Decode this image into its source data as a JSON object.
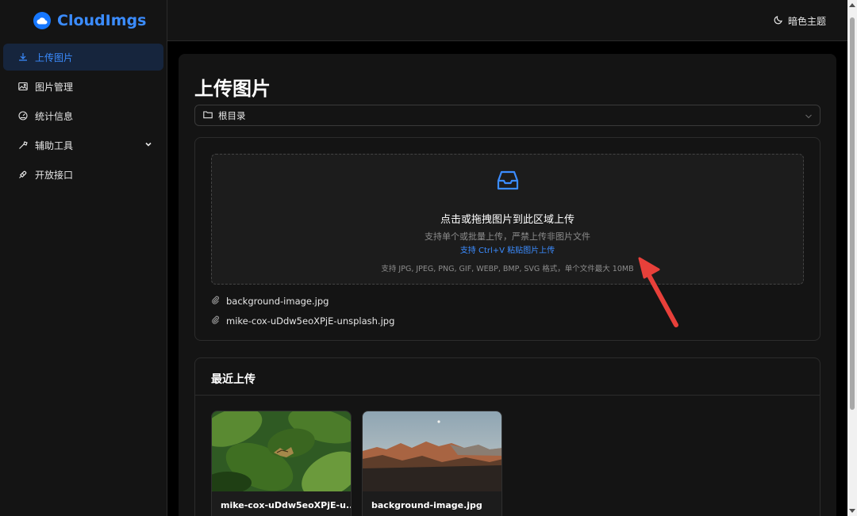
{
  "app": {
    "brand": "CloudImgs"
  },
  "sidebar": {
    "items": [
      {
        "label": "上传图片",
        "icon": "upload-icon",
        "active": true
      },
      {
        "label": "图片管理",
        "icon": "image-icon"
      },
      {
        "label": "统计信息",
        "icon": "dashboard-icon"
      },
      {
        "label": "辅助工具",
        "icon": "tool-icon",
        "expandable": true
      },
      {
        "label": "开放接口",
        "icon": "api-icon"
      }
    ]
  },
  "topbar": {
    "theme_label": "暗色主题"
  },
  "main": {
    "title": "上传图片",
    "directory": {
      "selected": "根目录"
    },
    "dropzone": {
      "title": "点击或拖拽图片到此区域上传",
      "hint": "支持单个或批量上传，严禁上传非图片文件",
      "paste_hint": "支持 Ctrl+V 粘贴图片上传",
      "formats": "支持 JPG, JPEG, PNG, GIF, WEBP, BMP, SVG 格式，单个文件最大 10MB"
    },
    "files": [
      "background-image.jpg",
      "mike-cox-uDdw5eoXPjE-unsplash.jpg"
    ],
    "recent": {
      "title": "最近上传",
      "items": [
        {
          "name": "mike-cox-uDdw5eoXPjE-u..."
        },
        {
          "name": "background-image.jpg"
        }
      ]
    }
  },
  "colors": {
    "accent": "#3b8cff",
    "annotation": "#e8403a"
  }
}
